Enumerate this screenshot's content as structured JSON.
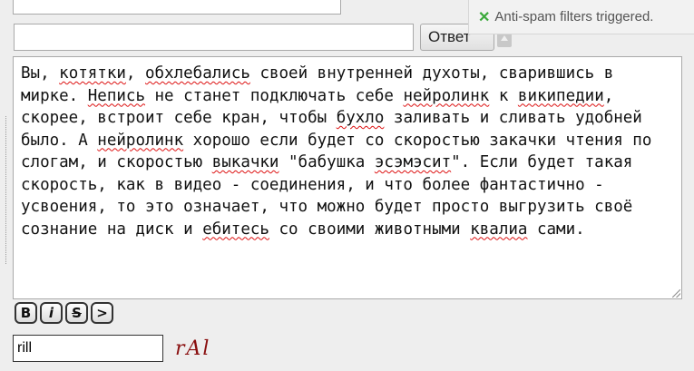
{
  "form": {
    "name_value": "",
    "submit_label": "Ответ",
    "comment_words": [
      {
        "t": "Вы, "
      },
      {
        "t": "котятки",
        "s": true
      },
      {
        "t": ", "
      },
      {
        "t": "обхлебались",
        "s": true
      },
      {
        "t": " своей внутренней духоты, сварившись в мирке. "
      },
      {
        "t": "Непись",
        "s": true
      },
      {
        "t": " не станет подключать себе "
      },
      {
        "t": "нейролинк",
        "s": true
      },
      {
        "t": " к "
      },
      {
        "t": "википедии",
        "s": true
      },
      {
        "t": ", скорее, встроит себе кран, чтобы "
      },
      {
        "t": "бухло",
        "s": true
      },
      {
        "t": " заливать и сливать удобней было. А "
      },
      {
        "t": "нейролинк",
        "s": true
      },
      {
        "t": " хорошо если будет со скоростью закачки чтения по слогам, и скоростью "
      },
      {
        "t": "выкачки",
        "s": true
      },
      {
        "t": " \"бабушка "
      },
      {
        "t": "эсэмэсит",
        "s": true
      },
      {
        "t": "\". Если будет такая скорость, как в видео - соединения, и что более фантастично - усвоения, то это означает, что можно будет просто выгрузить своё сознание на диск и "
      },
      {
        "t": "ебитесь",
        "s": true
      },
      {
        "t": " со своими животными "
      },
      {
        "t": "квалиа",
        "s": true
      },
      {
        "t": " сами."
      }
    ],
    "format_buttons": [
      {
        "label": "B",
        "name": "bold-button",
        "cls": "b"
      },
      {
        "label": "i",
        "name": "italic-button",
        "cls": "i"
      },
      {
        "label": "S",
        "name": "strike-button",
        "cls": "s"
      },
      {
        "label": ">",
        "name": "quote-button",
        "cls": "q"
      }
    ],
    "captcha_value": "rill",
    "captcha_image_text": "rAl"
  },
  "notification": {
    "icon": "check-icon",
    "text": "Anti-spam filters triggered."
  }
}
